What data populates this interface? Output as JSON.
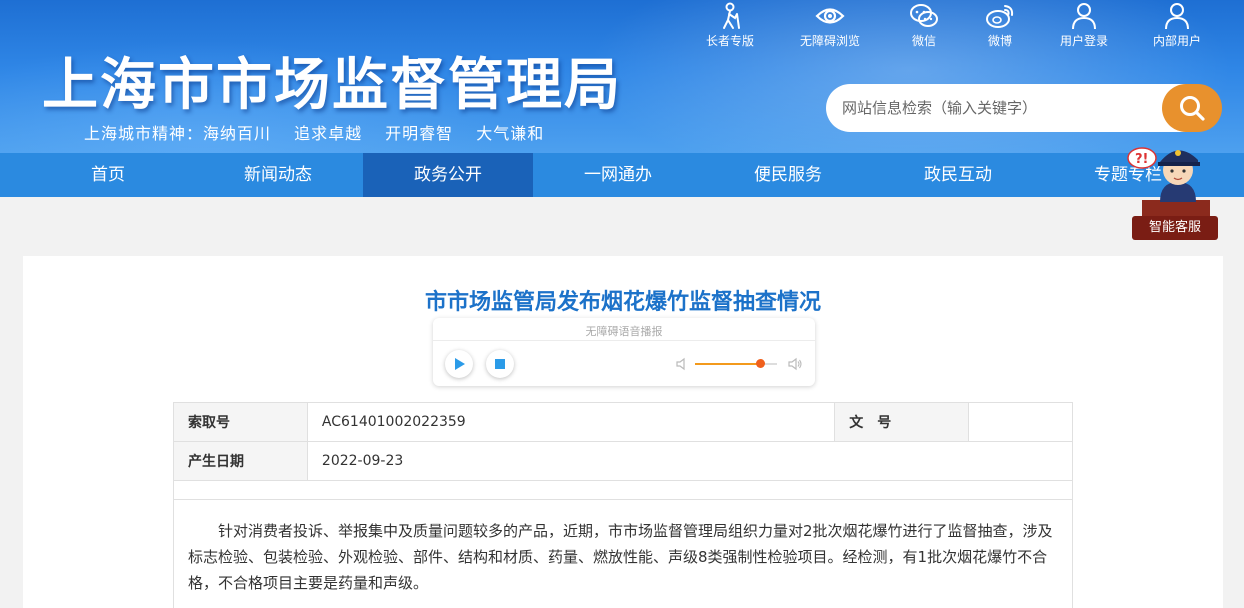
{
  "header": {
    "site_title": "上海市市场监督管理局",
    "slogan": "上海城市精神：海纳百川　 追求卓越 　开明睿智 　大气谦和"
  },
  "toolbar": [
    {
      "label": "长者专版",
      "icon": "elder-icon"
    },
    {
      "label": "无障碍浏览",
      "icon": "eye-icon"
    },
    {
      "label": "微信",
      "icon": "wechat-icon"
    },
    {
      "label": "微博",
      "icon": "weibo-icon"
    },
    {
      "label": "用户登录",
      "icon": "user-icon"
    },
    {
      "label": "内部用户",
      "icon": "user-icon"
    }
  ],
  "search": {
    "placeholder": "网站信息检索（输入关键字）",
    "icon": "search-icon"
  },
  "nav": [
    "首页",
    "新闻动态",
    "政务公开",
    "一网通办",
    "便民服务",
    "政民互动",
    "专题专栏"
  ],
  "nav_active": "政务公开",
  "assistant": {
    "label": "智能客服"
  },
  "article": {
    "title": "市市场监管局发布烟花爆竹监督抽查情况",
    "player_caption": "无障碍语音播报",
    "volume_level": 0.8,
    "meta": {
      "index_label": "索取号",
      "index_value": "AC61401002022359",
      "docno_label": "文　号",
      "docno_value": "",
      "date_label": "产生日期",
      "date_value": "2022-09-23"
    },
    "body": "针对消费者投诉、举报集中及质量问题较多的产品，近期，市市场监督管理局组织力量对2批次烟花爆竹进行了监督抽查，涉及标志检验、包装检验、外观检验、部件、结构和材质、药量、燃放性能、声级8类强制性检验项目。经检测，有1批次烟花爆竹不合格，不合格项目主要是药量和声级。"
  },
  "colors": {
    "primary": "#2b8ae0",
    "nav_active": "#1a62b8",
    "title": "#1c72c9",
    "search_btn": "#e8912d",
    "slider": "#f39a1c"
  }
}
